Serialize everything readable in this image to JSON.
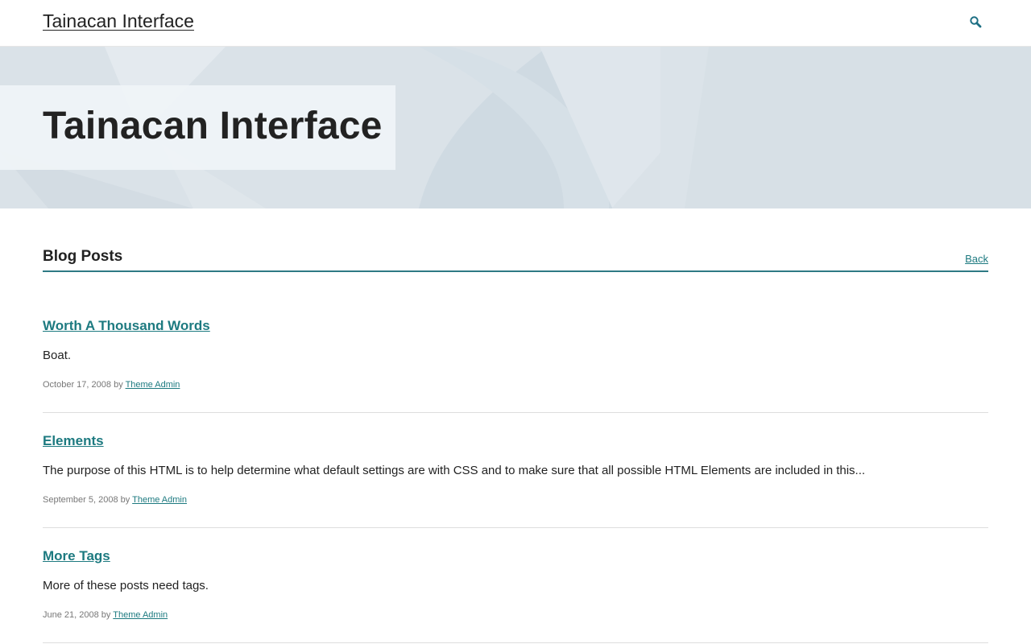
{
  "header": {
    "site_title": "Tainacan Interface",
    "search_icon": "search-icon"
  },
  "hero": {
    "title": "Tainacan Interface"
  },
  "section": {
    "title": "Blog Posts",
    "back_label": "Back"
  },
  "posts": [
    {
      "title": "Worth A Thousand Words",
      "excerpt": "Boat.",
      "date": "October 17, 2008",
      "by": "by",
      "author": "Theme Admin"
    },
    {
      "title": "Elements",
      "excerpt": "The purpose of this HTML is to help determine what default settings are with CSS and to make sure that all possible HTML Elements are included in this...",
      "date": "September 5, 2008",
      "by": "by",
      "author": "Theme Admin"
    },
    {
      "title": "More Tags",
      "excerpt": "More of these posts need tags.",
      "date": "June 21, 2008",
      "by": "by",
      "author": "Theme Admin"
    }
  ],
  "colors": {
    "accent": "#1d7a80",
    "rule": "#2e7a84",
    "hero_bg": "#dae2e8"
  }
}
